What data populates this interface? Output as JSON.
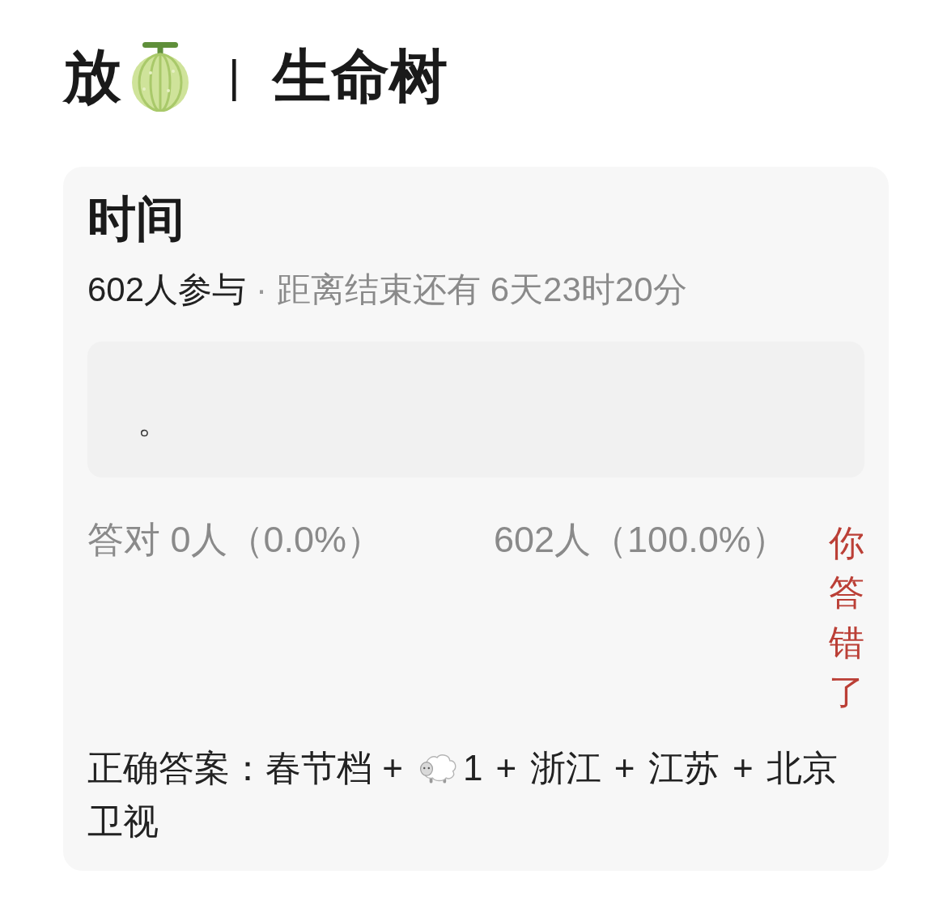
{
  "header": {
    "title_prefix": "放",
    "separator": "|",
    "title": "生命树"
  },
  "quiz_card": {
    "question": "时间",
    "meta": {
      "participants": "602人参与",
      "dot": "·",
      "deadline": "距离结束还有 6天23时20分"
    },
    "your_answer": {
      "value": "。"
    },
    "results": {
      "correct": "答对 0人（0.0%）",
      "wrong": "602人（100.0%）"
    },
    "verdict": {
      "text": "你答错了",
      "correct": false
    },
    "solution": {
      "label": "正确答案：",
      "before_icon": "春节档 +",
      "after_icon": "1 + 浙江 + 江苏 + 北京",
      "second_line": "卫视"
    }
  }
}
